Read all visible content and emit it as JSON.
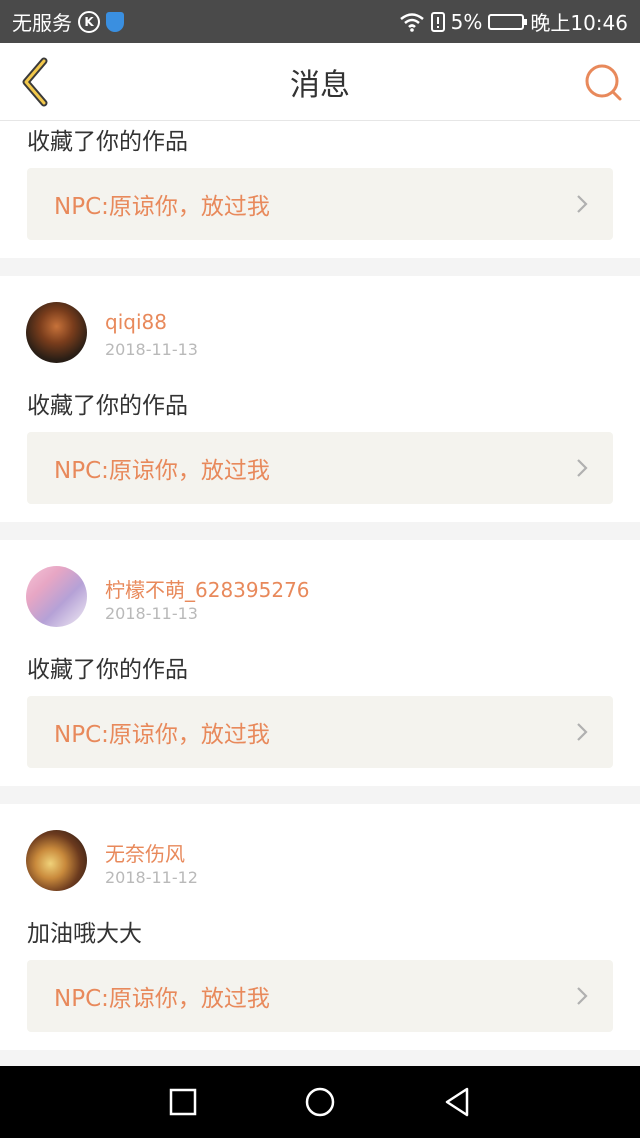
{
  "status": {
    "carrier": "无服务",
    "k_badge": "K",
    "battery": "5%",
    "time": "晚上10:46"
  },
  "header": {
    "title": "消息"
  },
  "items": [
    {
      "action": "收藏了你的作品",
      "quote": "NPC:原谅你，放过我"
    },
    {
      "name": "qiqi88",
      "date": "2018-11-13",
      "action": "收藏了你的作品",
      "quote": "NPC:原谅你，放过我"
    },
    {
      "name": "柠檬不萌_628395276",
      "date": "2018-11-13",
      "action": "收藏了你的作品",
      "quote": "NPC:原谅你，放过我"
    },
    {
      "name": "无奈伤风",
      "date": "2018-11-12",
      "action": "加油哦大大",
      "quote": "NPC:原谅你，放过我"
    }
  ],
  "colors": {
    "accent": "#e8895b",
    "quote_bg": "#f4f3ee",
    "status_bar": "#4a4a4a"
  }
}
